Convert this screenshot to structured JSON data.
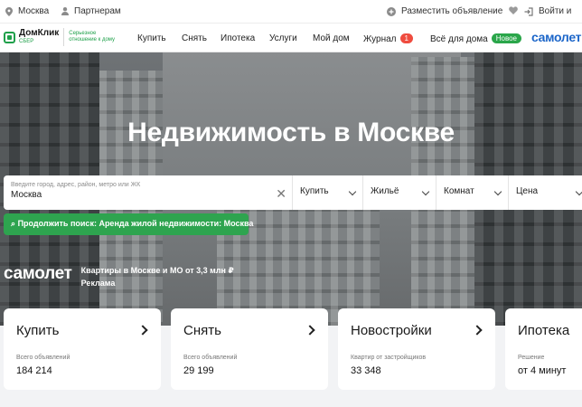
{
  "topbar": {
    "city": "Москва",
    "partners": "Партнерам",
    "place_ad": "Разместить объявление",
    "login": "Войти и"
  },
  "logo": {
    "name": "ДомКлик",
    "sub": "СБЕР",
    "slogan": "Серьезное отношение к дому"
  },
  "nav": {
    "items": [
      "Купить",
      "Снять",
      "Ипотека",
      "Услуги",
      "Мой дом"
    ],
    "journal": "Журнал",
    "journal_badge": "1",
    "all_home": "Всё для дома",
    "all_home_badge": "Новое",
    "partner": "самолет"
  },
  "hero": {
    "title": "Недвижимость в Москве"
  },
  "search": {
    "placeholder": "Введите город, адрес, район, метро или ЖК",
    "value": "Москва",
    "deal": "Купить",
    "type": "Жильё",
    "rooms": "Комнат",
    "price": "Цена"
  },
  "continue_search": "Продолжить поиск: Аренда жилой недвижимости: Москва",
  "ad": {
    "brand": "самолет",
    "text": "Квартиры в Москве и МО от 3,3 млн ₽",
    "label": "Реклама"
  },
  "cards": [
    {
      "title": "Купить",
      "sub": "Всего объявлений",
      "value": "184 214"
    },
    {
      "title": "Снять",
      "sub": "Всего объявлений",
      "value": "29 199"
    },
    {
      "title": "Новостройки",
      "sub": "Квартир от застройщиков",
      "value": "33 348"
    },
    {
      "title": "Ипотека",
      "sub": "Решение",
      "value": "от 4 минут"
    }
  ],
  "colors": {
    "brand_green": "#2ea44f",
    "partner_blue": "#1c66c9",
    "badge_red": "#ef4c3f"
  }
}
